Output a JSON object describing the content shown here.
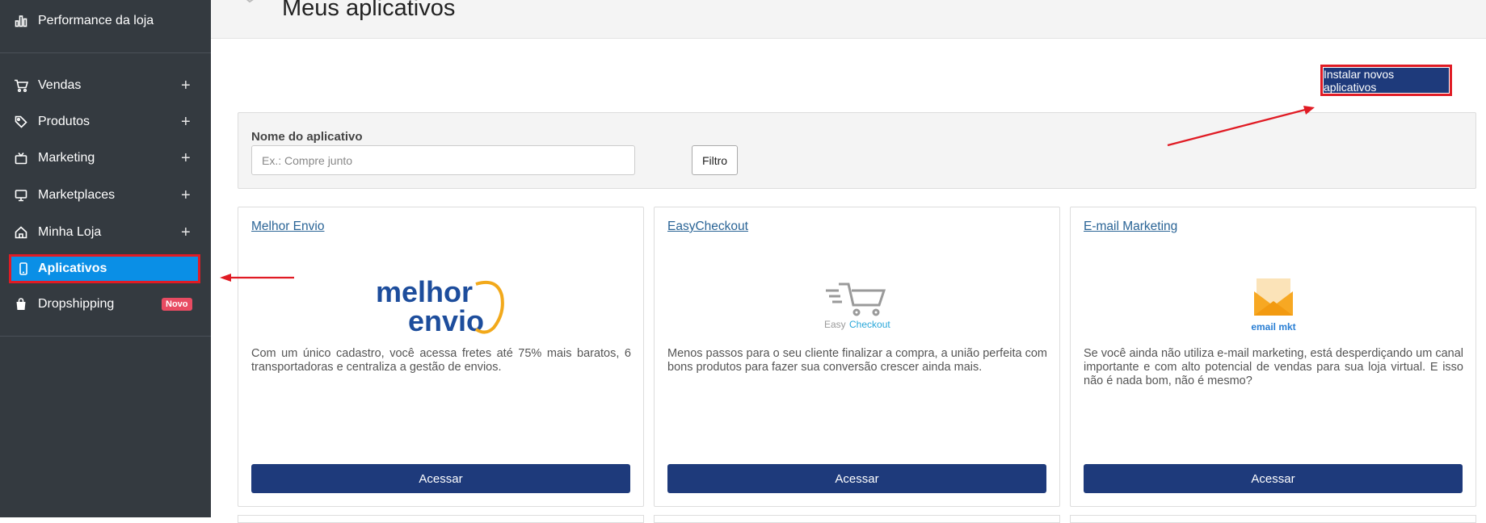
{
  "sidebar": {
    "top_item": {
      "label": "Performance da loja",
      "icon": "bar-chart-icon"
    },
    "items": [
      {
        "label": "Vendas",
        "icon": "cart-icon",
        "expand": "+"
      },
      {
        "label": "Produtos",
        "icon": "tag-icon",
        "expand": "+"
      },
      {
        "label": "Marketing",
        "icon": "tv-icon",
        "expand": "+"
      },
      {
        "label": "Marketplaces",
        "icon": "monitor-icon",
        "expand": "+"
      },
      {
        "label": "Minha Loja",
        "icon": "home-icon",
        "expand": "+"
      },
      {
        "label": "Aplicativos",
        "icon": "phone-icon",
        "active": true
      },
      {
        "label": "Dropshipping",
        "icon": "bag-icon",
        "badge": "Novo"
      }
    ]
  },
  "header": {
    "title": "Meus aplicativos"
  },
  "toolbar": {
    "install_label": "Instalar novos aplicativos"
  },
  "filter": {
    "label": "Nome do aplicativo",
    "placeholder": "Ex.: Compre junto",
    "button_label": "Filtro"
  },
  "apps": [
    {
      "title": "Melhor Envio",
      "logo_text_1": "melhor",
      "logo_text_2": "envio",
      "description": "Com um único cadastro, você acessa fretes até 75% mais baratos, 6 transportadoras e centraliza a gestão de envios.",
      "button_label": "Acessar"
    },
    {
      "title": "EasyCheckout",
      "logo_text_1": "Easy",
      "logo_text_2": "Checkout",
      "description": "Menos passos para o seu cliente finalizar a compra, a união perfeita com bons produtos para fazer sua conversão crescer ainda mais.",
      "button_label": "Acessar"
    },
    {
      "title": "E-mail Marketing",
      "logo_text_1": "email mkt",
      "description": "Se você ainda não utiliza e-mail marketing, está desperdiçando um canal importante e com alto potencial de vendas para sua loja virtual. E isso não é nada bom, não é mesmo?",
      "button_label": "Acessar"
    }
  ],
  "colors": {
    "sidebar_bg": "#343a40",
    "active_bg": "#0a8fe6",
    "primary_button": "#1e3a7b",
    "highlight_border": "#e01b24",
    "badge": "#e84b62",
    "link": "#2a6496"
  }
}
